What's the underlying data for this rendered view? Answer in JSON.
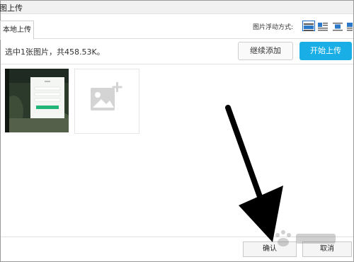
{
  "dialog": {
    "title": "图上传"
  },
  "tabs": [
    {
      "label": "本地上传"
    }
  ],
  "image_float": {
    "label": "图片浮动方式:",
    "icons": [
      {
        "name": "float-none-icon",
        "selected": true
      },
      {
        "name": "float-left-icon",
        "selected": false
      },
      {
        "name": "float-center-icon",
        "selected": false
      },
      {
        "name": "float-right-icon",
        "selected": false
      }
    ]
  },
  "upload": {
    "status": "选中1张图片，共458.53K。",
    "continue_label": "继续添加",
    "start_label": "开始上传"
  },
  "thumbnails": [
    {
      "kind": "screenshot"
    },
    {
      "kind": "placeholder",
      "icon": "image-add-icon"
    }
  ],
  "footer": {
    "confirm_label": "确认",
    "cancel_label": "取消"
  },
  "overlay": {
    "icon": "black-arrow-pointing-confirm"
  },
  "colors": {
    "start_button": "#19aee6",
    "icon_selected": "#1e6bbd",
    "icon_blue": "#2b78c8"
  }
}
